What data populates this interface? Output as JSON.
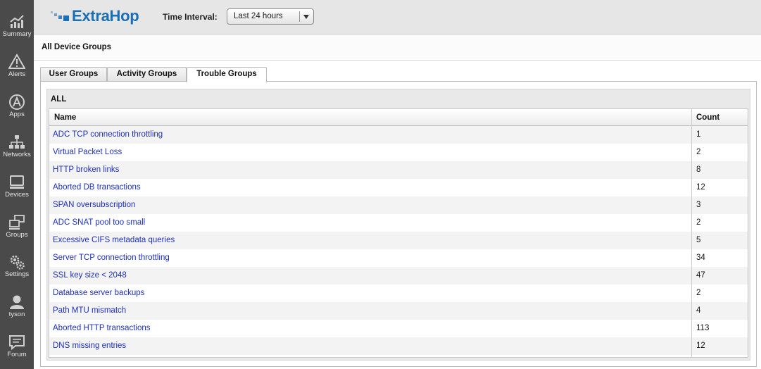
{
  "sidebar": {
    "items": [
      {
        "label": "Summary",
        "icon": "summary-icon"
      },
      {
        "label": "Alerts",
        "icon": "alert-icon"
      },
      {
        "label": "Apps",
        "icon": "apps-icon"
      },
      {
        "label": "Networks",
        "icon": "networks-icon"
      },
      {
        "label": "Devices",
        "icon": "devices-icon"
      },
      {
        "label": "Groups",
        "icon": "groups-icon"
      },
      {
        "label": "Settings",
        "icon": "gear-icon"
      },
      {
        "label": "tyson",
        "icon": "user-icon"
      },
      {
        "label": "Forum",
        "icon": "forum-icon"
      }
    ]
  },
  "header": {
    "logo_text": "ExtraHop",
    "brand_color": "#1a6fb5",
    "time_interval_label": "Time Interval:",
    "time_interval_value": "Last 24 hours"
  },
  "page": {
    "title": "All Device Groups"
  },
  "tabs": [
    {
      "label": "User Groups",
      "active": false
    },
    {
      "label": "Activity Groups",
      "active": false
    },
    {
      "label": "Trouble Groups",
      "active": true
    }
  ],
  "group": {
    "title": "ALL",
    "columns": {
      "name": "Name",
      "count": "Count"
    },
    "rows": [
      {
        "name": "ADC TCP connection throttling",
        "count": "1"
      },
      {
        "name": "Virtual Packet Loss",
        "count": "2"
      },
      {
        "name": "HTTP broken links",
        "count": "8"
      },
      {
        "name": "Aborted DB transactions",
        "count": "12"
      },
      {
        "name": "SPAN oversubscription",
        "count": "3"
      },
      {
        "name": "ADC SNAT pool too small",
        "count": "2"
      },
      {
        "name": "Excessive CIFS metadata queries",
        "count": "5"
      },
      {
        "name": "Server TCP connection throttling",
        "count": "34"
      },
      {
        "name": "SSL key size < 2048",
        "count": "47"
      },
      {
        "name": "Database server backups",
        "count": "2"
      },
      {
        "name": "Path MTU mismatch",
        "count": "4"
      },
      {
        "name": "Aborted HTTP transactions",
        "count": "113"
      },
      {
        "name": "DNS missing entries",
        "count": "12"
      }
    ]
  }
}
